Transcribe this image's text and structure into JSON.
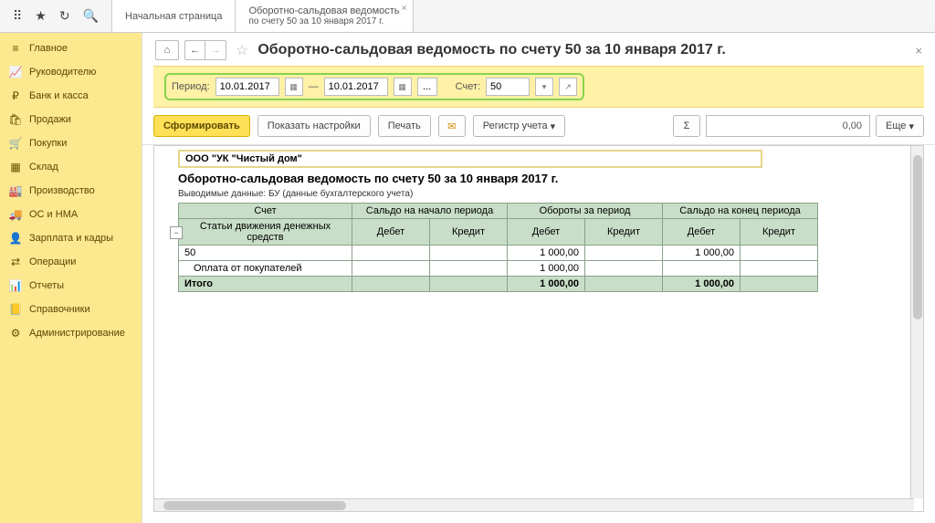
{
  "tabs": {
    "home": "Начальная страница",
    "active_line1": "Оборотно-сальдовая ведомость",
    "active_line2": "по счету 50 за 10 января 2017 г."
  },
  "sidebar": {
    "items": [
      {
        "icon": "≡",
        "label": "Главное"
      },
      {
        "icon": "📈",
        "label": "Руководителю"
      },
      {
        "icon": "₽",
        "label": "Банк и касса"
      },
      {
        "icon": "🛍",
        "label": "Продажи"
      },
      {
        "icon": "🛒",
        "label": "Покупки"
      },
      {
        "icon": "▦",
        "label": "Склад"
      },
      {
        "icon": "🏭",
        "label": "Производство"
      },
      {
        "icon": "🚚",
        "label": "ОС и НМА"
      },
      {
        "icon": "👤",
        "label": "Зарплата и кадры"
      },
      {
        "icon": "⇄",
        "label": "Операции"
      },
      {
        "icon": "📊",
        "label": "Отчеты"
      },
      {
        "icon": "📒",
        "label": "Справочники"
      },
      {
        "icon": "⚙",
        "label": "Администрирование"
      }
    ]
  },
  "page": {
    "title": "Оборотно-сальдовая ведомость по счету 50 за 10 января 2017 г."
  },
  "params": {
    "period_label": "Период:",
    "date_from": "10.01.2017",
    "dash": "—",
    "date_to": "10.01.2017",
    "dots": "...",
    "account_label": "Счет:",
    "account": "50"
  },
  "actions": {
    "form": "Сформировать",
    "show_settings": "Показать настройки",
    "print": "Печать",
    "register": "Регистр учета",
    "sum_sym": "Σ",
    "sum_val": "0,00",
    "more": "Еще"
  },
  "report": {
    "org": "ООО \"УК \"Чистый дом\"",
    "title": "Оборотно-сальдовая ведомость по счету 50 за 10 января 2017 г.",
    "subtitle": "Выводимые данные:   БУ (данные бухгалтерского учета)",
    "headers": {
      "col1_a": "Счет",
      "col1_b": "Статьи движения денежных средств",
      "grp1": "Сальдо на начало периода",
      "grp2": "Обороты за период",
      "grp3": "Сальдо на конец периода",
      "debit": "Дебет",
      "credit": "Кредит"
    },
    "rows": [
      {
        "name": "50",
        "ob_debit": "1 000,00",
        "end_debit": "1 000,00"
      },
      {
        "name": "Оплата от покупателей",
        "ob_debit": "1 000,00",
        "end_debit": ""
      }
    ],
    "total": {
      "label": "Итого",
      "ob_debit": "1 000,00",
      "end_debit": "1 000,00"
    }
  }
}
